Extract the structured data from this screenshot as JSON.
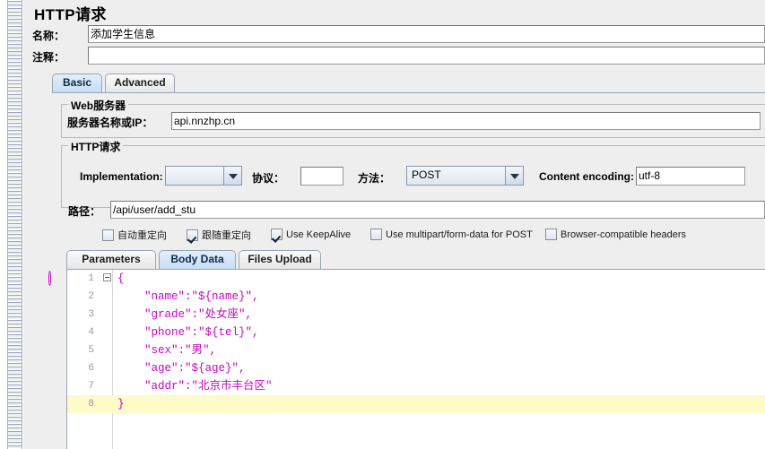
{
  "window": {
    "title": "HTTP请求"
  },
  "header": {
    "name_label": "名称：",
    "name_value": "添加学生信息",
    "comment_label": "注释：",
    "comment_value": ""
  },
  "tabs": [
    {
      "label": "Basic",
      "selected": true
    },
    {
      "label": "Advanced",
      "selected": false
    }
  ],
  "web_server": {
    "group_title": "Web服务器",
    "server_label": "服务器名称或IP：",
    "server_value": "api.nnzhp.cn"
  },
  "http_request": {
    "group_title": "HTTP请求",
    "implementation_label": "Implementation:",
    "implementation_value": "",
    "protocol_label": "协议：",
    "protocol_value": "",
    "method_label": "方法：",
    "method_value": "POST",
    "content_encoding_label": "Content encoding:",
    "content_encoding_value": "utf-8",
    "path_label": "路径：",
    "path_value": "/api/user/add_stu"
  },
  "checkboxes": [
    {
      "label": "自动重定向",
      "checked": false
    },
    {
      "label": "跟随重定向",
      "checked": true
    },
    {
      "label": "Use KeepAlive",
      "checked": true
    },
    {
      "label": "Use multipart/form-data for POST",
      "checked": false
    },
    {
      "label": "Browser-compatible headers",
      "checked": false
    }
  ],
  "inner_tabs": [
    {
      "label": "Parameters",
      "selected": false
    },
    {
      "label": "Body Data",
      "selected": true
    },
    {
      "label": "Files Upload",
      "selected": false
    }
  ],
  "editor": {
    "lines": [
      {
        "no": "1",
        "text": "{",
        "current": false,
        "fold": true
      },
      {
        "no": "2",
        "text": "    \"name\":\"${name}\",",
        "current": false,
        "fold": false
      },
      {
        "no": "3",
        "text": "    \"grade\":\"处女座\",",
        "current": false,
        "fold": false
      },
      {
        "no": "4",
        "text": "    \"phone\":\"${tel}\",",
        "current": false,
        "fold": false
      },
      {
        "no": "5",
        "text": "    \"sex\":\"男\",",
        "current": false,
        "fold": false
      },
      {
        "no": "6",
        "text": "    \"age\":\"${age}\",",
        "current": false,
        "fold": false
      },
      {
        "no": "7",
        "text": "    \"addr\":\"北京市丰台区\"",
        "current": false,
        "fold": false
      },
      {
        "no": "8",
        "text": "}",
        "current": true,
        "fold": false
      }
    ],
    "syntax_color": "#c207c2",
    "current_line_color": "#fdfbc8"
  }
}
